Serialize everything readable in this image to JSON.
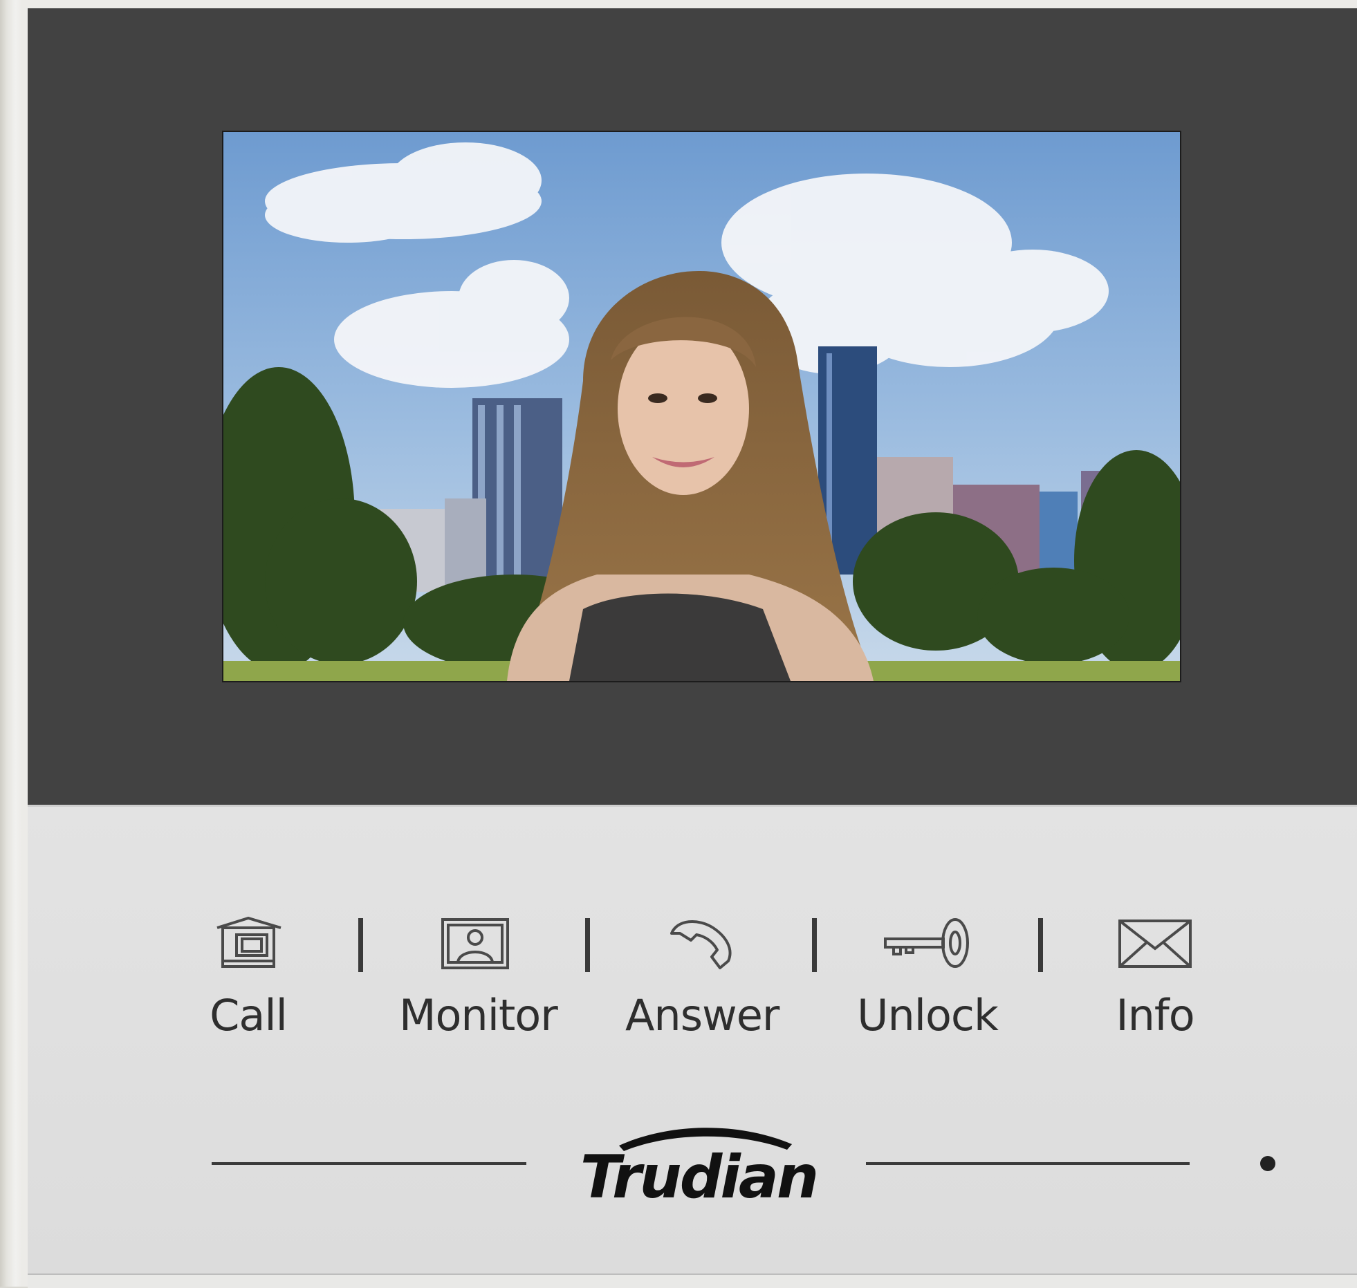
{
  "device": {
    "brand": "Trudian",
    "buttons": [
      {
        "id": "call",
        "label": "Call",
        "icon": "call-icon"
      },
      {
        "id": "monitor",
        "label": "Monitor",
        "icon": "monitor-icon"
      },
      {
        "id": "answer",
        "label": "Answer",
        "icon": "phone-handset-icon"
      },
      {
        "id": "unlock",
        "label": "Unlock",
        "icon": "key-icon"
      },
      {
        "id": "info",
        "label": "Info",
        "icon": "envelope-icon"
      }
    ]
  },
  "colors": {
    "bezel": "#424242",
    "panel": "#dedede",
    "text": "#2e2e2e",
    "sky": "#7ea6d6"
  }
}
